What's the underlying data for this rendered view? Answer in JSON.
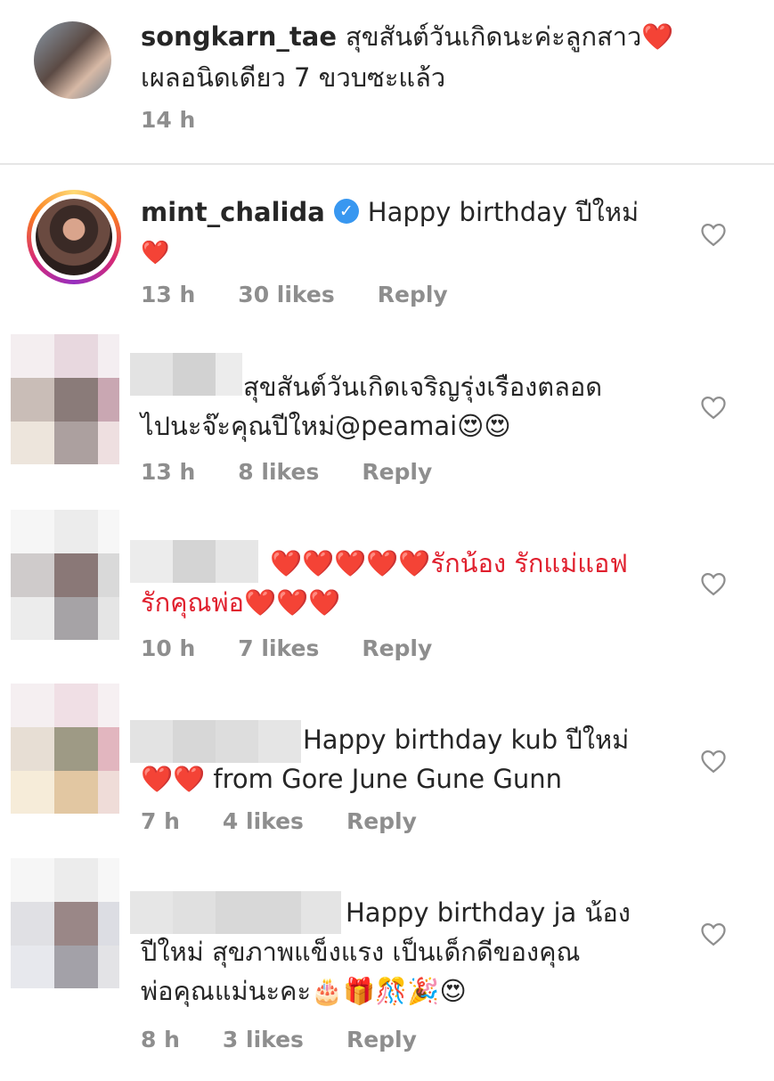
{
  "caption": {
    "username": "songkarn_tae",
    "text_line1": "สุขสันต์วันเกิดนะค่ะลูกสาว❤️",
    "text_line2": "เผลอนิดเดียว 7 ขวบซะแล้ว",
    "time": "14 h"
  },
  "comments": [
    {
      "username": "mint_chalida",
      "verified": true,
      "text_line1": "Happy birthday ปีใหม่",
      "text_line2": "❤️",
      "time": "13 h",
      "likes": "30 likes",
      "reply": "Reply"
    },
    {
      "text_line1": "สุขสันต์วันเกิดเจริญรุ่งเรืองตลอด",
      "text_line2": "ไปนะจ๊ะคุณปีใหม่@peamai😍😍",
      "time": "13 h",
      "likes": "8 likes",
      "reply": "Reply"
    },
    {
      "text_line1": "❤️❤️❤️❤️❤️รักน้อง รักแม่แอฟ",
      "text_line2": "รักคุณพ่อ❤️❤️❤️",
      "time": "10 h",
      "likes": "7 likes",
      "reply": "Reply"
    },
    {
      "text_line1": "Happy birthday kub ปีใหม่",
      "text_line2": "❤️❤️ from Gore June Gune Gunn",
      "time": "7 h",
      "likes": "4 likes",
      "reply": "Reply"
    },
    {
      "text_line1": "Happy birthday ja น้อง",
      "text_line2": "ปีใหม่ สุขภาพแข็งแรง  เป็นเด็กดีของคุณ",
      "text_line3": "พ่อคุณแม่นะคะ🎂🎁🎊🎉😍",
      "time": "8 h",
      "likes": "3 likes",
      "reply": "Reply"
    }
  ]
}
